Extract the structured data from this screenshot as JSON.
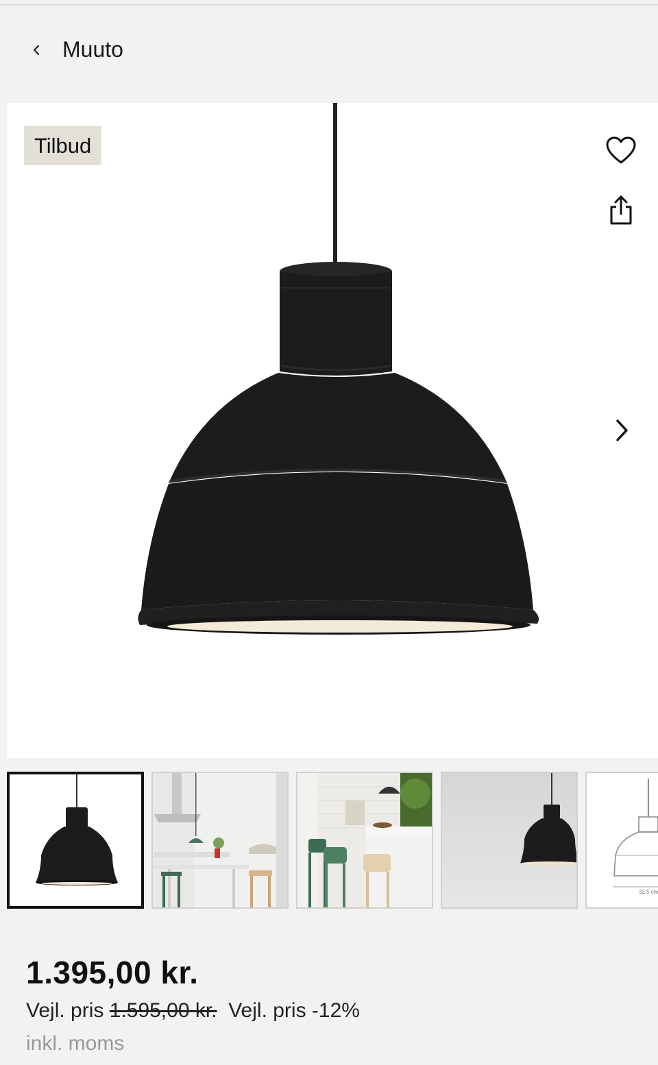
{
  "header": {
    "brand": "Muuto",
    "back_icon": "chevron-left-icon"
  },
  "product": {
    "badge": "Tilbud",
    "favorite_icon": "heart-icon",
    "share_icon": "share-icon",
    "next_icon": "chevron-right-icon",
    "images_count_visible": 5
  },
  "pricing": {
    "price": "1.395,00 kr.",
    "rrp_label": "Vejl. pris",
    "rrp_value": "1.595,00 kr.",
    "discount_label": "Vejl. pris -12%",
    "vat_note": "inkl. moms"
  },
  "thumbnails": [
    {
      "name": "lamp-product-thumb",
      "active": true
    },
    {
      "name": "kitchen-scene-thumb",
      "active": false
    },
    {
      "name": "barstool-scene-thumb",
      "active": false
    },
    {
      "name": "lamp-grey-thumb",
      "active": false
    },
    {
      "name": "lamp-dimension-thumb",
      "active": false,
      "caption": "32,5 cm"
    }
  ],
  "colors": {
    "background": "#f2f2f2",
    "badge_bg": "#e3e0d8",
    "lamp": "#1c1c1c"
  }
}
